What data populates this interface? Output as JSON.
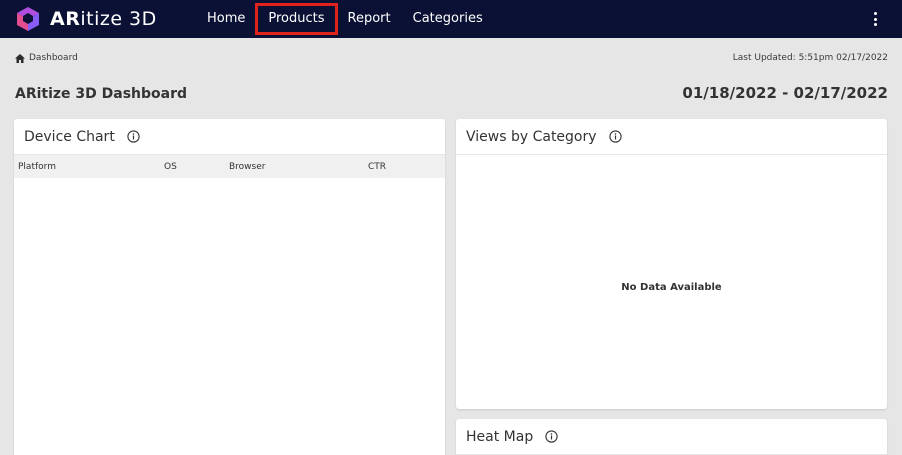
{
  "app": {
    "logo_bold": "AR",
    "logo_rest": "itize 3D",
    "logo_colors": {
      "left": "#e44d8f",
      "right": "#8a5cf6",
      "top": "#b04ee0"
    }
  },
  "nav": {
    "items": [
      "Home",
      "Products",
      "Report",
      "Categories"
    ],
    "highlight_color": "#e0231c",
    "menu_icon": "more-vertical-icon"
  },
  "breadcrumb": {
    "icon": "home-icon",
    "label": "Dashboard"
  },
  "last_updated": "Last Updated: 5:51pm 02/17/2022",
  "page_title": "ARitize 3D Dashboard",
  "date_range": "01/18/2022 - 02/17/2022",
  "device_chart": {
    "title": "Device Chart",
    "columns": [
      "Platform",
      "OS",
      "Browser",
      "CTR"
    ]
  },
  "views_by_category": {
    "title": "Views by Category",
    "empty_message": "No Data Available"
  },
  "heat_map": {
    "title": "Heat Map"
  },
  "colors": {
    "topbar": "#0b1135",
    "background": "#e6e6e6"
  }
}
